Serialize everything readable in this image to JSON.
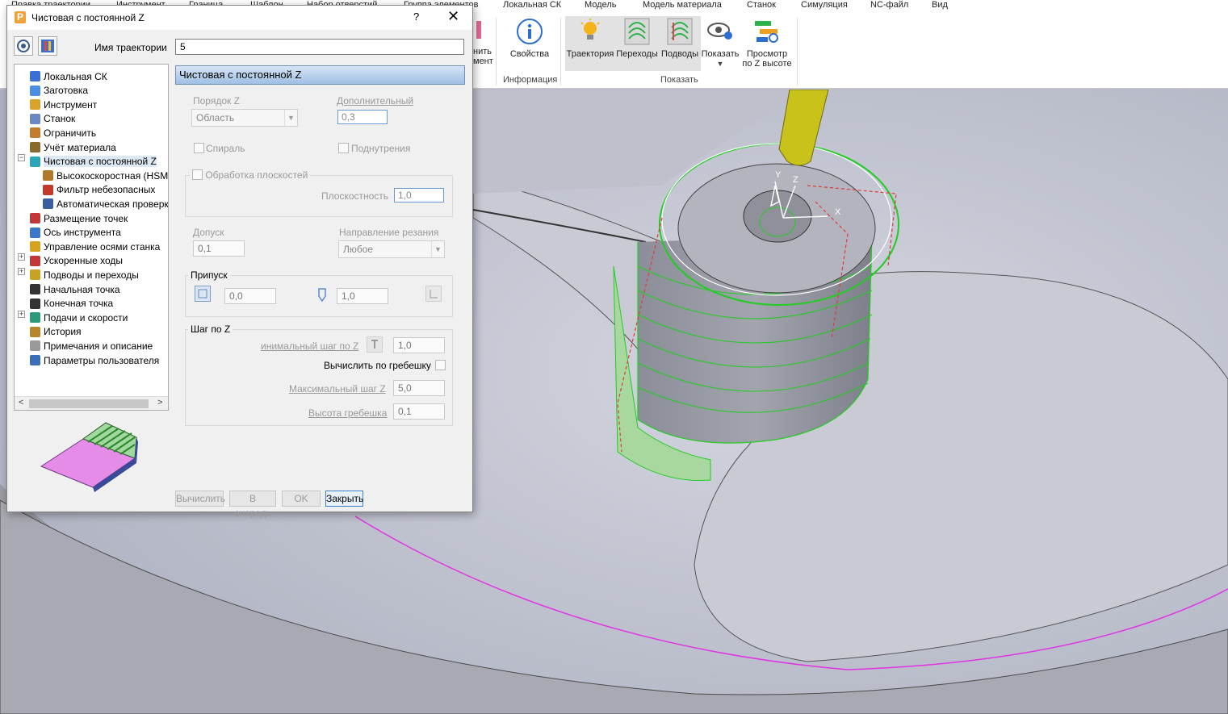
{
  "menu": [
    "Правка траектории",
    "Инструмент",
    "Граница",
    "Шаблон",
    "Набор отверстий",
    "Группа элементов",
    "Локальная СК",
    "Модель",
    "Модель материала",
    "Станок",
    "Симуляция",
    "NC-файл",
    "Вид"
  ],
  "ribbon": {
    "partial_button": "нить\nмент",
    "properties": "Свойства",
    "info_group": "Информация",
    "trajectory": "Траектория",
    "links": "Переходы",
    "leads": "Подводы",
    "show": "Показать",
    "z_view": "Просмотр\nпо Z высоте",
    "show_group": "Показать"
  },
  "dialog": {
    "title": "Чистовая с постоянной Z",
    "help": "?",
    "close": "✕",
    "name_label": "Имя траектории",
    "name_value": "5",
    "tree": [
      {
        "label": "Локальная СК",
        "color": "#3a6fd6"
      },
      {
        "label": "Заготовка",
        "color": "#4b8ee0"
      },
      {
        "label": "Инструмент",
        "color": "#d8a32a"
      },
      {
        "label": "Станок",
        "color": "#6b88c4"
      },
      {
        "label": "Ограничить",
        "color": "#c27a2c"
      },
      {
        "label": "Учёт материала",
        "color": "#8a6a2a"
      },
      {
        "label": "Чистовая с постоянной Z",
        "color": "#2aa6b6"
      },
      {
        "label": "Высокоскоростная (HSM)",
        "color": "#b07a2a"
      },
      {
        "label": "Фильтр небезопасных",
        "color": "#c23a2a"
      },
      {
        "label": "Автоматическая проверк",
        "color": "#3a5fa0"
      },
      {
        "label": "Размещение точек",
        "color": "#c2383a"
      },
      {
        "label": "Ось инструмента",
        "color": "#3a78c8"
      },
      {
        "label": "Управление осями станка",
        "color": "#d7a21e"
      },
      {
        "label": "Ускоренные ходы",
        "color": "#c2383a"
      },
      {
        "label": "Подводы и переходы",
        "color": "#c7a225"
      },
      {
        "label": "Начальная точка",
        "color": "#333333"
      },
      {
        "label": "Конечная точка",
        "color": "#333333"
      },
      {
        "label": "Подачи и скорости",
        "color": "#2a9a7a"
      },
      {
        "label": "История",
        "color": "#b8862a"
      },
      {
        "label": "Примечания и описание",
        "color": "#9a9a9a"
      },
      {
        "label": "Параметры пользователя",
        "color": "#3a6fb6"
      }
    ],
    "section_title": "Чистовая с постоянной Z",
    "z_order_label": "Порядок Z",
    "z_order_value": "Область",
    "additional_label": "Дополнительный",
    "additional_value": "0,3",
    "spiral_label": "Спираль",
    "undercuts_label": "Поднутрения",
    "flats_label": "Обработка плоскостей",
    "flatness_label": "Плоскостность",
    "flatness_value": "1,0",
    "tolerance_label": "Допуск",
    "tolerance_value": "0,1",
    "cut_dir_label": "Направление резания",
    "cut_dir_value": "Любое",
    "allowance_label": "Припуск",
    "allowance_radial": "0,0",
    "allowance_axial": "1,0",
    "stepdown_label": "Шаг по Z",
    "min_step_label": "инимальный шаг по Z",
    "min_step_value": "1,0",
    "calc_cusp_label": "Вычислить по гребешку",
    "max_step_label": "Максимальный шаг Z",
    "max_step_value": "5,0",
    "cusp_label": "Высота гребешка",
    "cusp_value": "0,1",
    "btn_calc": "Вычислить",
    "btn_queue": "В очередь",
    "btn_ok": "OK",
    "btn_close": "Закрыть"
  },
  "viewport": {
    "axis_x": "X",
    "axis_y": "Y",
    "axis_z": "Z"
  },
  "colors": {
    "toolpath": "#22cc22",
    "boundary": "#e233e2",
    "lead": "#e23a3a",
    "tool": "#c9c21a",
    "model": "#a9a9b1"
  }
}
